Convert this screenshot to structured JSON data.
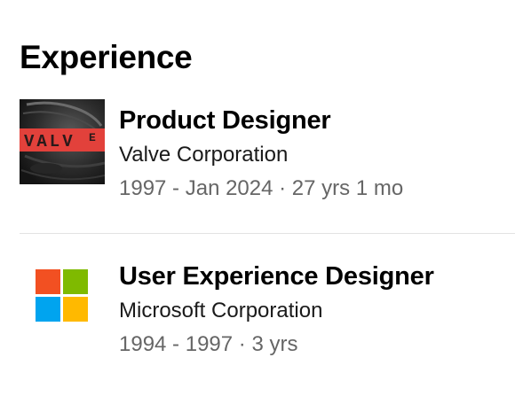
{
  "section": {
    "title": "Experience"
  },
  "experiences": [
    {
      "role": "Product Designer",
      "company": "Valve Corporation",
      "dates": "1997 - Jan 2024 · 27 yrs 1 mo",
      "logo": {
        "icon": "valve-logo-icon",
        "text": "VALVE",
        "colors": {
          "background": "#1d1d1d",
          "band": "#e2413b",
          "text": "#2a1a1a"
        }
      }
    },
    {
      "role": "User Experience Designer",
      "company": "Microsoft Corporation",
      "dates": "1994 - 1997 · 3 yrs",
      "logo": {
        "icon": "microsoft-logo-icon",
        "colors": {
          "top_left": "#f25022",
          "top_right": "#7fba00",
          "bottom_left": "#00a4ef",
          "bottom_right": "#ffb900"
        }
      }
    }
  ]
}
